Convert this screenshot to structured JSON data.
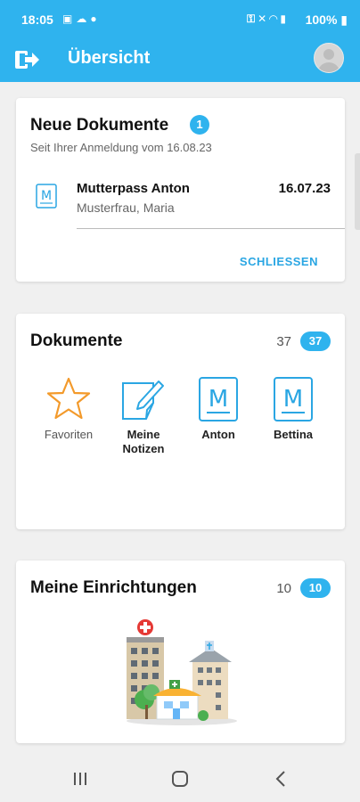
{
  "status_bar": {
    "time": "18:05",
    "battery": "100%",
    "left_icons": [
      "gallery-icon",
      "cloud-icon",
      "location-icon"
    ],
    "right_icons": [
      "key-icon",
      "mute-icon",
      "wifi-icon",
      "signal-icon"
    ]
  },
  "app_bar": {
    "title": "Übersicht"
  },
  "new_documents": {
    "title": "Neue Dokumente",
    "badge": "1",
    "subtitle": "Seit Ihrer Anmeldung vom 16.08.23",
    "item": {
      "title": "Mutterpass Anton",
      "date": "16.07.23",
      "author": "Musterfrau, Maria"
    },
    "close_label": "SCHLIESSEN"
  },
  "documents": {
    "title": "Dokumente",
    "count": "37",
    "badge": "37",
    "tiles": [
      {
        "label": "Favoriten",
        "icon": "star-icon"
      },
      {
        "label": "Meine Notizen",
        "icon": "notes-icon"
      },
      {
        "label": "Anton",
        "icon": "mutterpass-icon"
      },
      {
        "label": "Bettina",
        "icon": "mutterpass-icon"
      }
    ]
  },
  "institutions": {
    "title": "Meine Einrichtungen",
    "count": "10",
    "badge": "10"
  },
  "colors": {
    "accent": "#2fb3ee",
    "star": "#f39a2b",
    "icon_blue": "#2aa6e3",
    "background": "#f0f0f0"
  },
  "nav_bar": {
    "buttons": [
      "recent-apps-icon",
      "home-icon",
      "back-icon"
    ]
  }
}
